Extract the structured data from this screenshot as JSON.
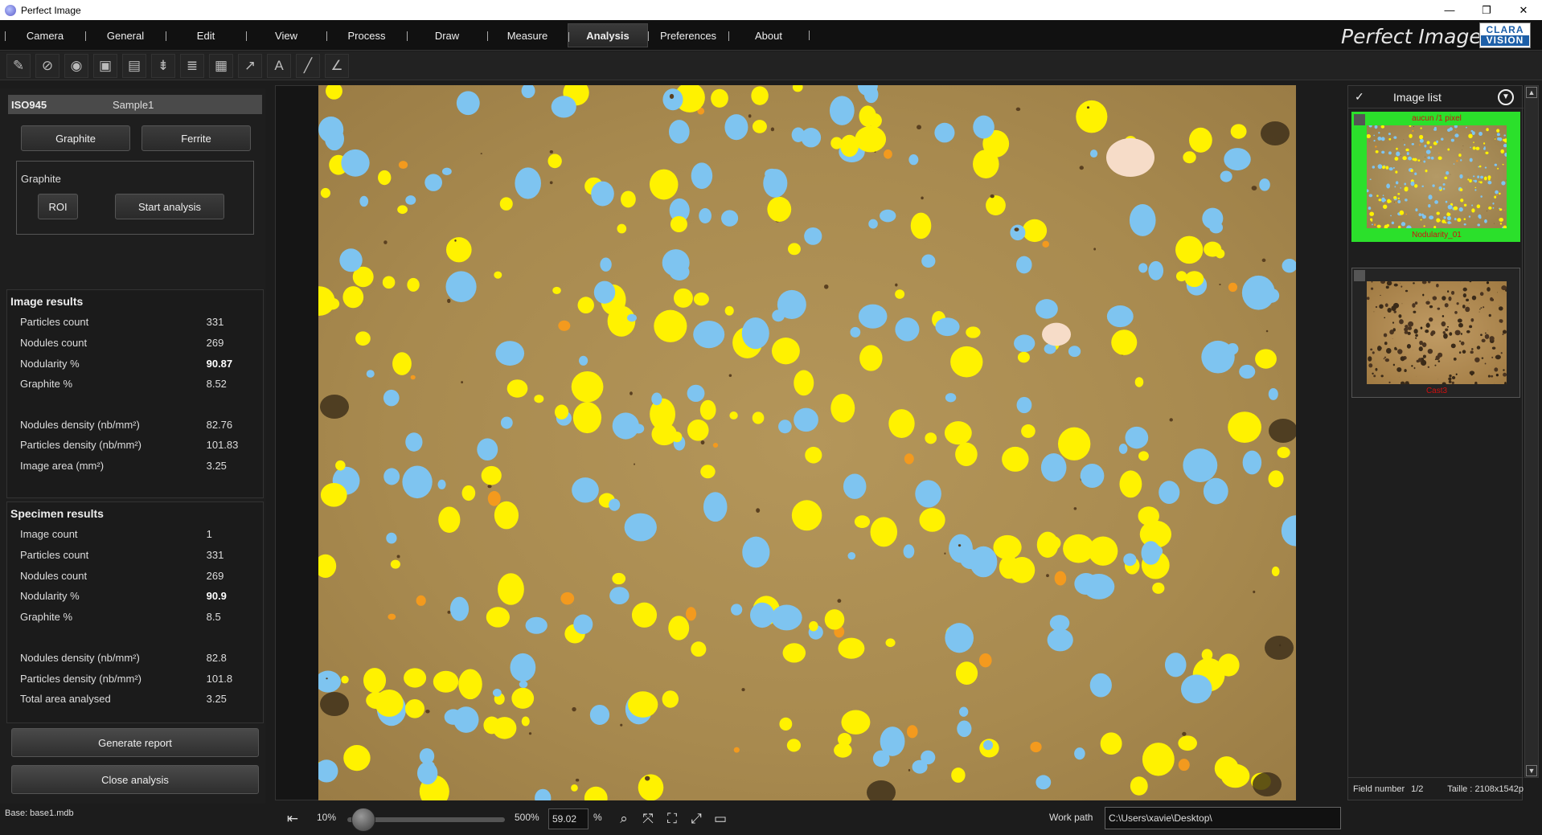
{
  "window": {
    "title": "Perfect Image",
    "controls": {
      "minimize": "—",
      "restore": "❐",
      "close": "✕"
    }
  },
  "menu": {
    "items": [
      {
        "label": "Camera"
      },
      {
        "label": "General"
      },
      {
        "label": "Edit"
      },
      {
        "label": "View"
      },
      {
        "label": "Process"
      },
      {
        "label": "Draw"
      },
      {
        "label": "Measure"
      },
      {
        "label": "Analysis",
        "active": true
      },
      {
        "label": "Preferences"
      },
      {
        "label": "About"
      }
    ],
    "brand": "Perfect Image",
    "logo_top": "CLARA",
    "logo_bottom": "VISION"
  },
  "toolbar": {
    "icons": [
      "edit-icon",
      "camera-off-icon",
      "camera-icon",
      "gallery-icon",
      "save-icon",
      "layers-icon",
      "stack-icon",
      "grid-add-icon",
      "arrow-icon",
      "text-icon",
      "line-icon",
      "angle-icon"
    ]
  },
  "left": {
    "standard": "ISO945",
    "sample": "Sample1",
    "btn_graphite": "Graphite",
    "btn_ferrite": "Ferrite",
    "group_title": "Graphite",
    "btn_roi": "ROI",
    "btn_start": "Start analysis",
    "image_results": {
      "title": "Image results",
      "rows": [
        {
          "label": "Particles count",
          "value": "331"
        },
        {
          "label": "Nodules count",
          "value": "269"
        },
        {
          "label": "Nodularity %",
          "value": "90.87"
        },
        {
          "label": "Graphite %",
          "value": "8.52"
        },
        {
          "label": "Nodules density (nb/mm²)",
          "value": "82.76"
        },
        {
          "label": "Particles density (nb/mm²)",
          "value": "101.83"
        },
        {
          "label": "Image area (mm²)",
          "value": "3.25"
        }
      ]
    },
    "specimen_results": {
      "title": "Specimen results",
      "rows": [
        {
          "label": "Image count",
          "value": "1"
        },
        {
          "label": "Particles count",
          "value": "331"
        },
        {
          "label": "Nodules count",
          "value": "269"
        },
        {
          "label": "Nodularity %",
          "value": "90.9"
        },
        {
          "label": "Graphite %",
          "value": "8.5"
        },
        {
          "label": "Nodules density (nb/mm²)",
          "value": "82.8"
        },
        {
          "label": "Particles density (nb/mm²)",
          "value": "101.8"
        },
        {
          "label": "Total area analysed",
          "value": "3.25"
        }
      ]
    },
    "btn_report": "Generate report",
    "btn_close": "Close analysis"
  },
  "image_list": {
    "title": "Image list",
    "check": "✓",
    "thumbs": [
      {
        "top_label": "aucun /1 pixel",
        "bottom_label": "Nodularity_01",
        "selected": true
      },
      {
        "top_label": "",
        "bottom_label": "Cast3",
        "selected": false
      }
    ],
    "field_label": "Field number",
    "field_value": "1/2",
    "size_label": "Taille :",
    "size_value": "2108x1542p"
  },
  "bottom": {
    "status": "Base: base1.mdb",
    "zoom_min": "10%",
    "zoom_max": "500%",
    "zoom_value": "59.02",
    "zoom_unit": "%",
    "zoom_level": 0.1,
    "work_path_label": "Work path",
    "work_path": "C:\\Users\\xavie\\Desktop\\"
  },
  "colors": {
    "nodule_yellow": "#fff200",
    "nodule_blue": "#7ec4f0",
    "orange": "#f39a1e",
    "magenta": "#e020a0",
    "pink_white": "#f6dcc8",
    "green_selected": "#2be02b"
  }
}
